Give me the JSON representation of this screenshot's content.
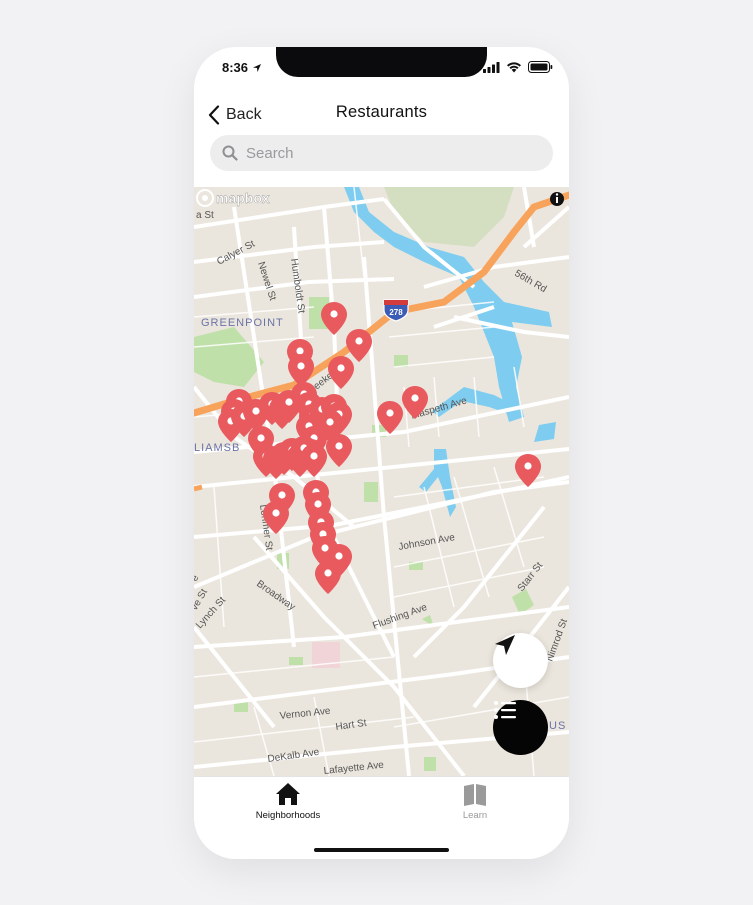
{
  "status": {
    "time": "8:36"
  },
  "nav": {
    "back_label": "Back",
    "title": "Restaurants"
  },
  "search": {
    "placeholder": "Search"
  },
  "map": {
    "attribution": "mapbox",
    "interstate_shield": "278",
    "neighborhoods": {
      "greenpoint": "GREENPOINT",
      "williamsburg": "LIAMSB",
      "bushwick": "US"
    },
    "streets": {
      "calyer": "Calyer St",
      "newel": "Newel St",
      "humboldt": "Humboldt St",
      "meeker": "Meeker Ave",
      "maspeth": "Maspeth Ave",
      "fifty_sixth": "56th Rd",
      "lorimer": "Lorimer St",
      "johnson": "Johnson Ave",
      "starr": "Starr St",
      "broadway": "Broadway",
      "flushing": "Flushing Ave",
      "lynch": "Lynch St",
      "vernon": "Vernon Ave",
      "hart": "Hart St",
      "dekalb": "DeKalb Ave",
      "lafayette": "Lafayette Ave",
      "nimrod": "Nimrod St",
      "small_st": "a St",
      "small_ave": "ve St",
      "small_ave2": "e"
    },
    "pin_color": "#e85a5e"
  },
  "tabs": [
    {
      "label": "Neighborhoods",
      "icon": "home-icon",
      "active": true
    },
    {
      "label": "Learn",
      "icon": "book-icon",
      "active": false
    }
  ],
  "colors": {
    "water": "#7ecdf0",
    "highway": "#f7a35c",
    "park": "#b9dfa2",
    "active_tab": "#111111",
    "inactive_tab": "#999999"
  }
}
